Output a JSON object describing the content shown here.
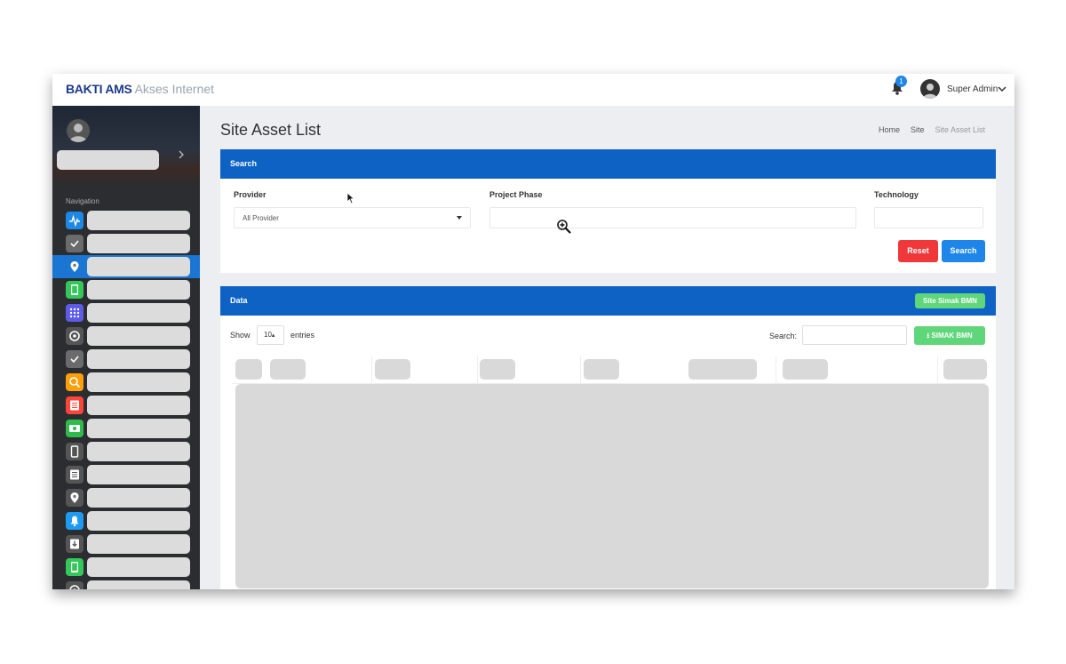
{
  "app": {
    "brand_bold": "BAKTI AMS",
    "brand_light": "Akses Internet"
  },
  "header": {
    "notification_count": "1",
    "user_name": "Super Admin"
  },
  "sidebar": {
    "nav_label": "Navigation",
    "items": [
      {
        "icon": "pulse-icon",
        "color": "#1e88e5",
        "active": false
      },
      {
        "icon": "check-icon",
        "color": "#6b6b6b",
        "active": false
      },
      {
        "icon": "location-pin-icon",
        "color": "#1a76d2",
        "active": true
      },
      {
        "icon": "tablet-icon",
        "color": "#34c759",
        "active": false
      },
      {
        "icon": "apps-grid-icon",
        "color": "#5e5ce6",
        "active": false
      },
      {
        "icon": "settings-icon",
        "color": "#555555",
        "active": false
      },
      {
        "icon": "check-icon",
        "color": "#6b6b6b",
        "active": false
      },
      {
        "icon": "search-icon",
        "color": "#ff9f0a",
        "active": false
      },
      {
        "icon": "list-icon",
        "color": "#ff453a",
        "active": false
      },
      {
        "icon": "money-icon",
        "color": "#30b94d",
        "active": false
      },
      {
        "icon": "phone-icon",
        "color": "#555555",
        "active": false
      },
      {
        "icon": "document-icon",
        "color": "#555555",
        "active": false
      },
      {
        "icon": "location-pin-icon",
        "color": "#555555",
        "active": false
      },
      {
        "icon": "bell-icon",
        "color": "#1e9bf0",
        "active": false
      },
      {
        "icon": "download-icon",
        "color": "#555555",
        "active": false
      },
      {
        "icon": "tablet-icon",
        "color": "#34c759",
        "active": false
      },
      {
        "icon": "settings-icon",
        "color": "#555555",
        "active": false
      }
    ]
  },
  "page": {
    "title": "Site Asset List",
    "breadcrumb": [
      "Home",
      "Site",
      "Site Asset List"
    ]
  },
  "search_panel": {
    "title": "Search",
    "provider_label": "Provider",
    "provider_value": "All Provider",
    "project_phase_label": "Project Phase",
    "technology_label": "Technology",
    "reset_label": "Reset",
    "search_label": "Search"
  },
  "data_panel": {
    "title": "Data",
    "site_simak_label": "Site Simak BMN",
    "show_label": "Show",
    "entries_value": "10",
    "entries_label": "entries",
    "search_label": "Search:",
    "export_label": "SIMAK BMN"
  },
  "colors": {
    "panel_header": "#0d62c4",
    "reset": "#f0383b",
    "search": "#1d86e8",
    "green": "#5fd67a"
  }
}
